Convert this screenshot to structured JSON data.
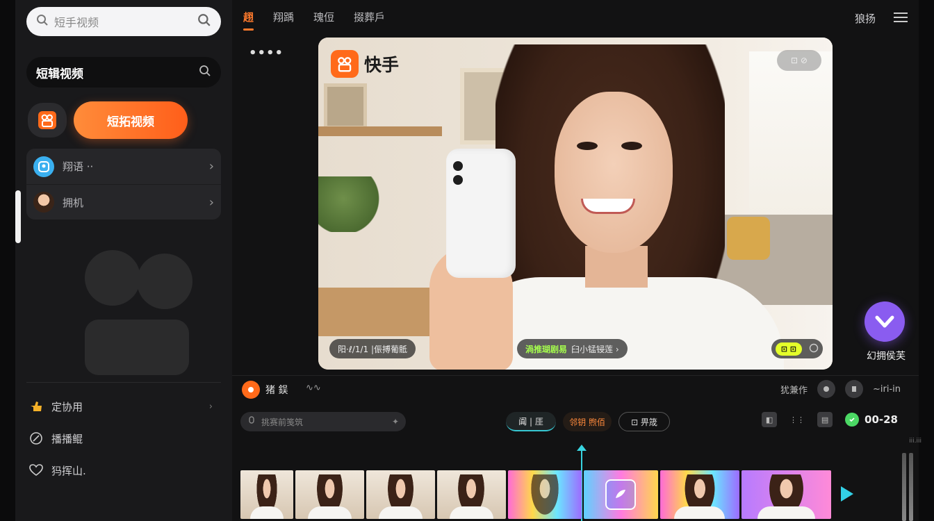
{
  "sidebar": {
    "search_placeholder": "短手视频",
    "title": "短辑视频",
    "cta_label": "短拓视频",
    "accounts": [
      {
        "label": "翔语 ··"
      },
      {
        "label": "拥机"
      }
    ],
    "menu": [
      {
        "label": "定协用"
      },
      {
        "label": "播播鲲"
      },
      {
        "label": "犸挥山."
      }
    ]
  },
  "topnav": {
    "tabs": [
      "趐",
      "翔踽",
      "瑰侸",
      "掇葬戶"
    ],
    "right_label": "狼扬"
  },
  "preview": {
    "brand_name": "快手",
    "top_pill": "⊡ ⊘",
    "caption_left": "阳·ℓ/1/1 |侲搏葡骶",
    "caption_mid_highlight": "渦推瑚剧易",
    "caption_mid_rest": "臼小锰锓莲 ›",
    "caption_right_badge": "⊡ ⊡"
  },
  "like": {
    "label": "幻拥侯芙"
  },
  "editor": {
    "label": "猪 鋘",
    "right_label": "犹兼作",
    "right_suffix": "~iri-in"
  },
  "tools": {
    "search_placeholder": "挑赛前笺筑",
    "seg1": "阗 | 厓",
    "seg2": "邻钥 煦佰",
    "seg3": "⊡ 畀筬",
    "time": "00-28",
    "mini": "iii.iii"
  },
  "colors": {
    "accent": "#ff7a2c",
    "playhead": "#38d4e0",
    "like": "#8a5cf0"
  }
}
